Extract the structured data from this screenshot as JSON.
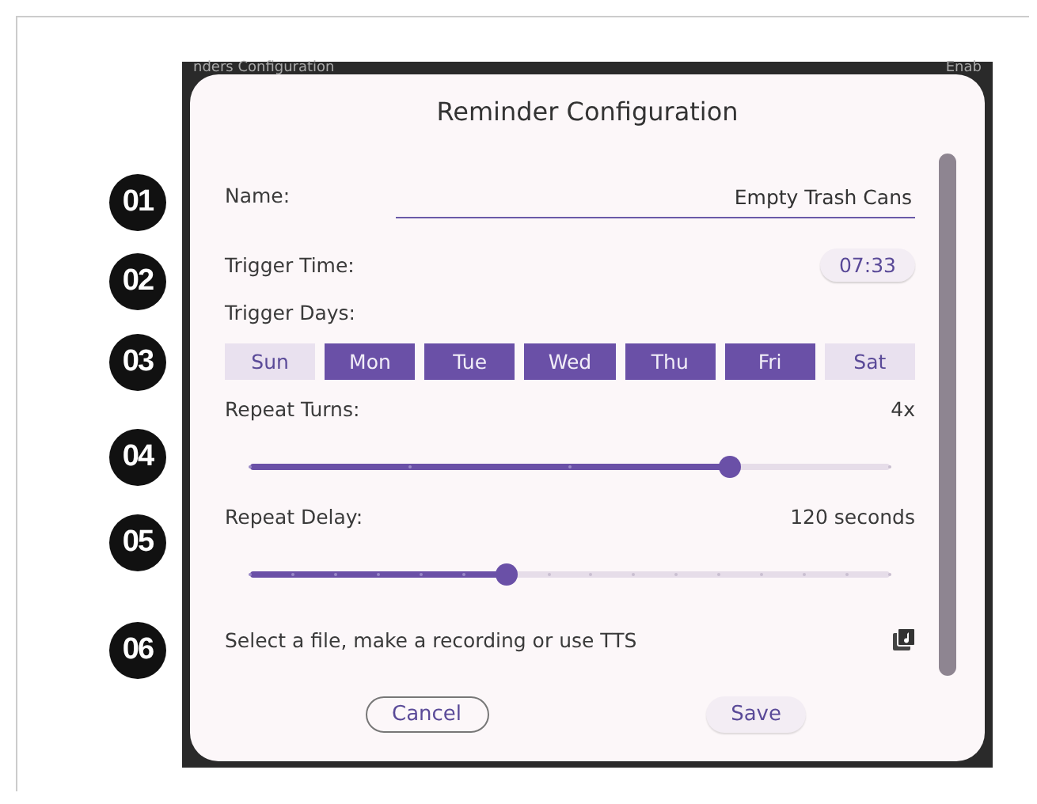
{
  "markers": [
    "01",
    "02",
    "03",
    "04",
    "05",
    "06"
  ],
  "background": {
    "title": "nders Configuration",
    "action": "Enab"
  },
  "dialog": {
    "title": "Reminder Configuration",
    "name": {
      "label": "Name:",
      "value": "Empty Trash Cans"
    },
    "trigger_time": {
      "label": "Trigger Time:",
      "value": "07:33"
    },
    "trigger_days": {
      "label": "Trigger Days:",
      "days": [
        {
          "label": "Sun",
          "selected": false
        },
        {
          "label": "Mon",
          "selected": true
        },
        {
          "label": "Tue",
          "selected": true
        },
        {
          "label": "Wed",
          "selected": true
        },
        {
          "label": "Thu",
          "selected": true
        },
        {
          "label": "Fri",
          "selected": true
        },
        {
          "label": "Sat",
          "selected": false
        }
      ]
    },
    "sliders": [
      {
        "label": "Repeat Turns:",
        "reading": "4x",
        "level": 0.75
      },
      {
        "label": "Repeat Delay:",
        "reading": "120 seconds",
        "level": 0.4
      }
    ],
    "sound": {
      "label": "Select a file, make a recording or use TTS"
    },
    "buttons": [
      {
        "label": "Cancel",
        "kind": "outlined"
      },
      {
        "label": "Save",
        "kind": "tonal"
      }
    ]
  }
}
